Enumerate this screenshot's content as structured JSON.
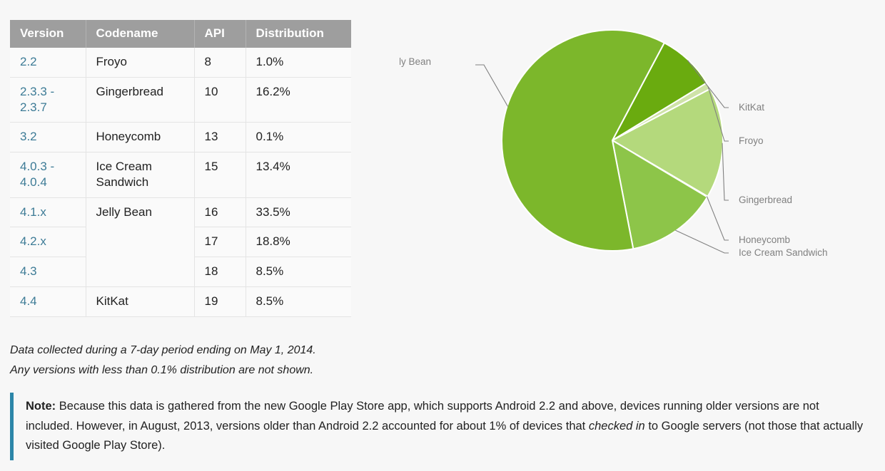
{
  "table": {
    "headers": [
      "Version",
      "Codename",
      "API",
      "Distribution"
    ],
    "rows": [
      {
        "version": "2.2",
        "codename": "Froyo",
        "api": "8",
        "distribution": "1.0%"
      },
      {
        "version": "2.3.3 - 2.3.7",
        "codename": "Gingerbread",
        "api": "10",
        "distribution": "16.2%"
      },
      {
        "version": "3.2",
        "codename": "Honeycomb",
        "api": "13",
        "distribution": "0.1%"
      },
      {
        "version": "4.0.3 - 4.0.4",
        "codename": "Ice Cream Sandwich",
        "api": "15",
        "distribution": "13.4%"
      },
      {
        "version": "4.1.x",
        "codename": "Jelly Bean",
        "api": "16",
        "distribution": "33.5%"
      },
      {
        "version": "4.2.x",
        "codename": "",
        "api": "17",
        "distribution": "18.8%"
      },
      {
        "version": "4.3",
        "codename": "",
        "api": "18",
        "distribution": "8.5%"
      },
      {
        "version": "4.4",
        "codename": "KitKat",
        "api": "19",
        "distribution": "8.5%"
      }
    ]
  },
  "caption": {
    "line1": "Data collected during a 7-day period ending on May 1, 2014.",
    "line2": "Any versions with less than 0.1% distribution are not shown."
  },
  "note": {
    "label": "Note:",
    "text_part1": " Because this data is gathered from the new Google Play Store app, which supports Android 2.2 and above, devices running older versions are not included. However, in August, 2013, versions older than Android 2.2 accounted for about 1% of devices that ",
    "emphasis": "checked in",
    "text_part2": " to Google servers (not those that actually visited Google Play Store).",
    "accent_color": "#2c86a8"
  },
  "chart_data": {
    "type": "pie",
    "title": "",
    "legend_position": "callout-labels",
    "labels": [
      "Jelly Bean",
      "KitKat",
      "Froyo",
      "Gingerbread",
      "Honeycomb",
      "Ice Cream Sandwich"
    ],
    "values": [
      60.8,
      8.5,
      1.0,
      16.2,
      0.1,
      13.4
    ],
    "colors": [
      "#7cb72b",
      "#6aab0f",
      "#cfe3a8",
      "#b4d97c",
      "#c6e096",
      "#8dc549"
    ],
    "slices": [
      {
        "label": "Jelly Bean",
        "value": 60.8,
        "color": "#7cb72b"
      },
      {
        "label": "KitKat",
        "value": 8.5,
        "color": "#6aab0f"
      },
      {
        "label": "Froyo",
        "value": 1.0,
        "color": "#cfe3a8"
      },
      {
        "label": "Gingerbread",
        "value": 16.2,
        "color": "#b4d97c"
      },
      {
        "label": "Honeycomb",
        "value": 0.1,
        "color": "#c6e096"
      },
      {
        "label": "Ice Cream Sandwich",
        "value": 13.4,
        "color": "#8dc549"
      }
    ]
  }
}
